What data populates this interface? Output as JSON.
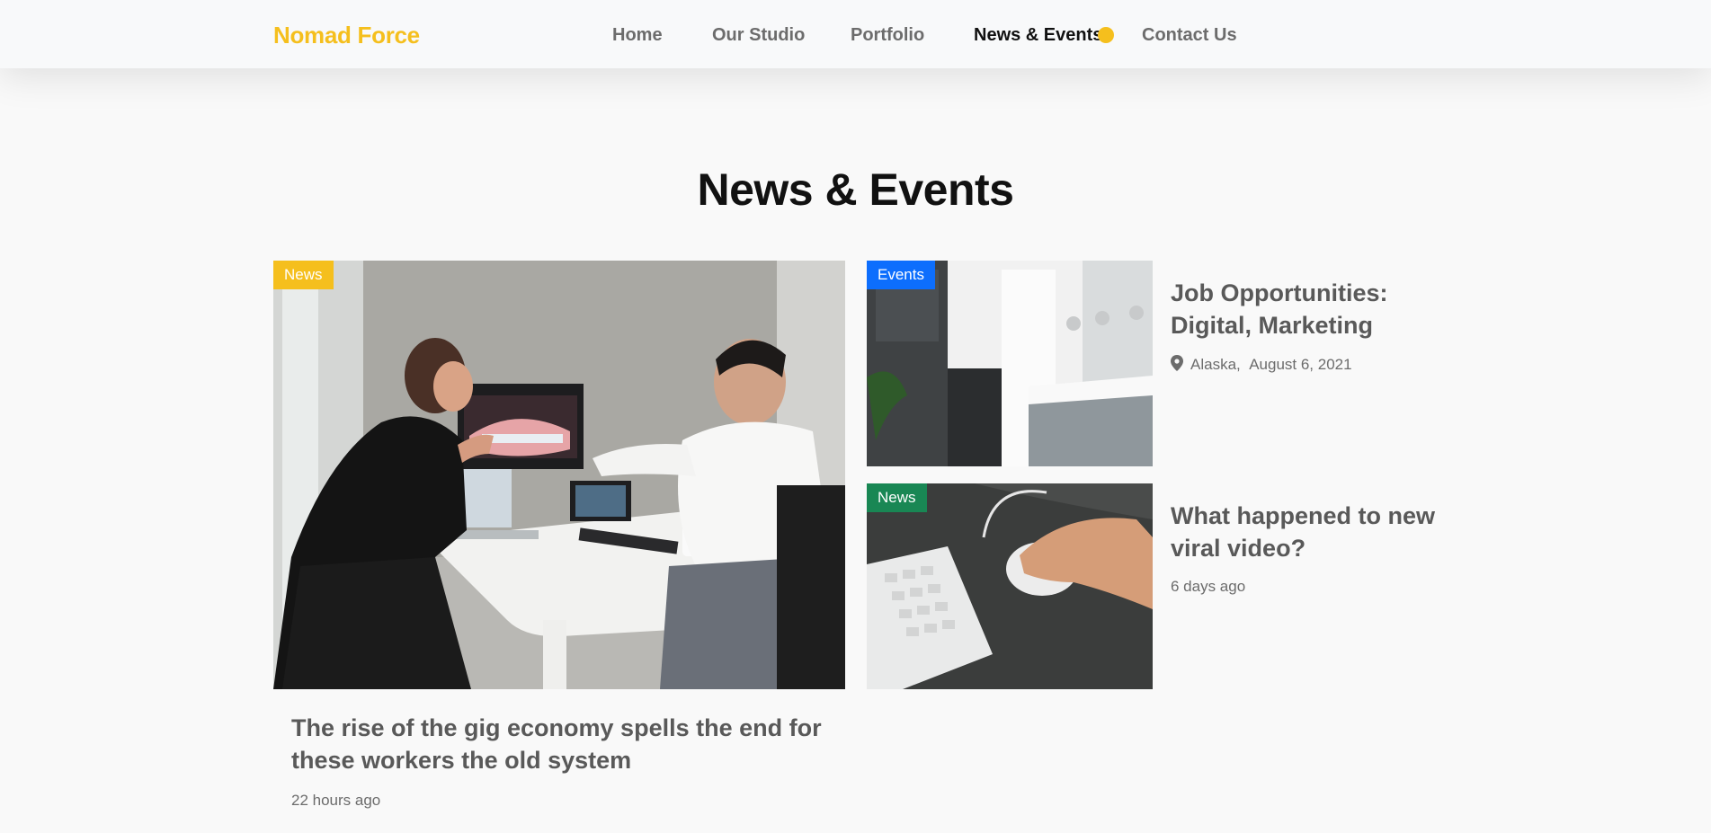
{
  "brand": "Nomad Force",
  "nav": {
    "items": [
      "Home",
      "Our Studio",
      "Portfolio",
      "News & Events",
      "Contact Us"
    ],
    "active": "News & Events"
  },
  "colors": {
    "brand": "#f5bf1d",
    "news_badge": "#f5bf1d",
    "events_badge": "#0d6efd",
    "news_badge_alt": "#198754"
  },
  "section_title": "News & Events",
  "featured": {
    "badge": "News",
    "title": "The rise of the gig economy spells the end for these workers the old system",
    "time": "22 hours ago"
  },
  "side_posts": [
    {
      "badge": "Events",
      "title": "Job Opportunities: Digital, Marketing",
      "location": "Alaska,",
      "date": "August 6, 2021",
      "icon": "map-pin-icon"
    },
    {
      "badge": "News",
      "title": "What happened to new viral video?",
      "time": "6 days ago"
    }
  ]
}
